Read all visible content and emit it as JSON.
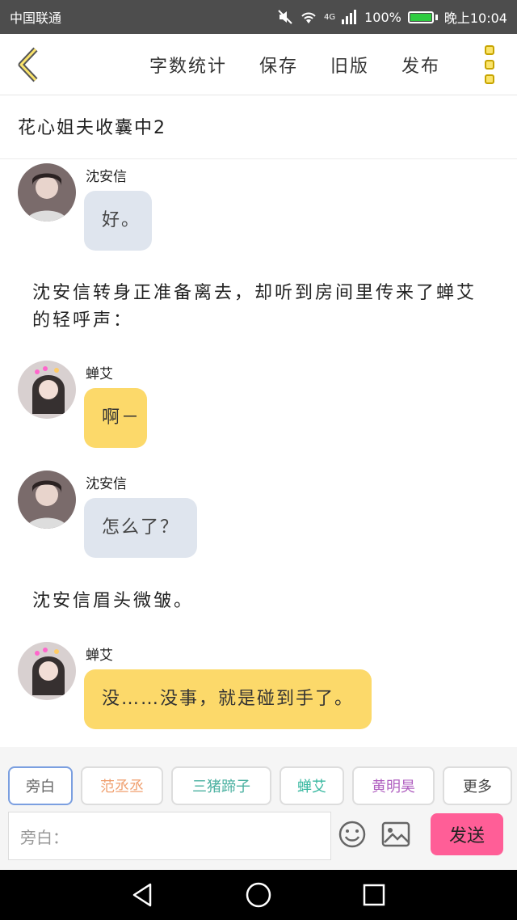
{
  "status_bar": {
    "carrier": "中国联通",
    "network": "4G",
    "battery": "100%",
    "time": "晚上10:04"
  },
  "toolbar": {
    "tools": [
      {
        "label": "字数统计"
      },
      {
        "label": "保存"
      },
      {
        "label": "旧版"
      },
      {
        "label": "发布"
      }
    ]
  },
  "story_title": "花心姐夫收囊中2",
  "messages": [
    {
      "name": "沈安信",
      "text": "好。",
      "bubble": "blue"
    },
    {
      "narration": "沈安信转身正准备离去，却听到房间里传来了蝉艾的轻呼声："
    },
    {
      "name": "蝉艾",
      "text": "啊－",
      "bubble": "yellow"
    },
    {
      "name": "沈安信",
      "text": "怎么了？",
      "bubble": "blue"
    },
    {
      "narration": "沈安信眉头微皱。"
    },
    {
      "name": "蝉艾",
      "text": "没……没事，就是碰到手了。",
      "bubble": "yellow"
    }
  ],
  "role_chips": [
    {
      "label": "旁白",
      "color": "#666666"
    },
    {
      "label": "范丞丞",
      "color": "#f0a070"
    },
    {
      "label": "三猪蹄子",
      "color": "#4ab0a0"
    },
    {
      "label": "蝉艾",
      "color": "#38b8a0"
    },
    {
      "label": "黄明昊",
      "color": "#b060c0"
    },
    {
      "label": "更多",
      "color": "#444444"
    }
  ],
  "composer": {
    "placeholder": "旁白：",
    "send_label": "发送"
  },
  "colors": {
    "accent_yellow": "#fcd96a",
    "send_pink": "#ff5e97",
    "bubble_blue": "#dfe5ee"
  }
}
